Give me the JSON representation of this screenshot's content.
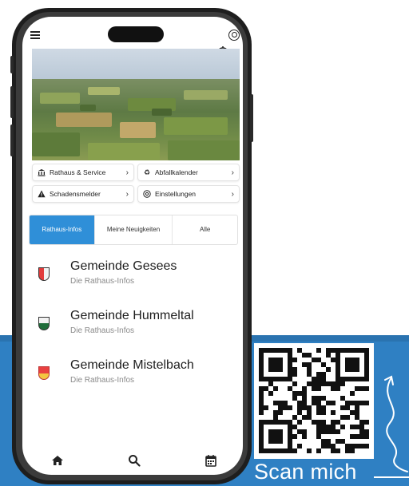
{
  "promo": {
    "scan_label": "Scan mich"
  },
  "app": {
    "quick_links": [
      {
        "label": "Rathaus & Service",
        "icon": "building-icon"
      },
      {
        "label": "Abfallkalender",
        "icon": "recycle-icon"
      },
      {
        "label": "Schadensmelder",
        "icon": "warning-icon"
      },
      {
        "label": "Einstellungen",
        "icon": "settings-icon"
      }
    ],
    "tabs": [
      {
        "label": "Rathaus-Infos",
        "active": true
      },
      {
        "label": "Meine Neuigkeiten",
        "active": false
      },
      {
        "label": "Alle",
        "active": false
      }
    ],
    "list": [
      {
        "title": "Gemeinde Gesees",
        "subtitle": "Die Rathaus-Infos"
      },
      {
        "title": "Gemeinde Hummeltal",
        "subtitle": "Die Rathaus-Infos"
      },
      {
        "title": "Gemeinde Mistelbach",
        "subtitle": "Die Rathaus-Infos"
      }
    ],
    "bottom_nav": [
      "home-icon",
      "search-icon",
      "calendar-icon"
    ]
  },
  "colors": {
    "accent": "#2f8fd8",
    "band": "#2f80c3"
  }
}
